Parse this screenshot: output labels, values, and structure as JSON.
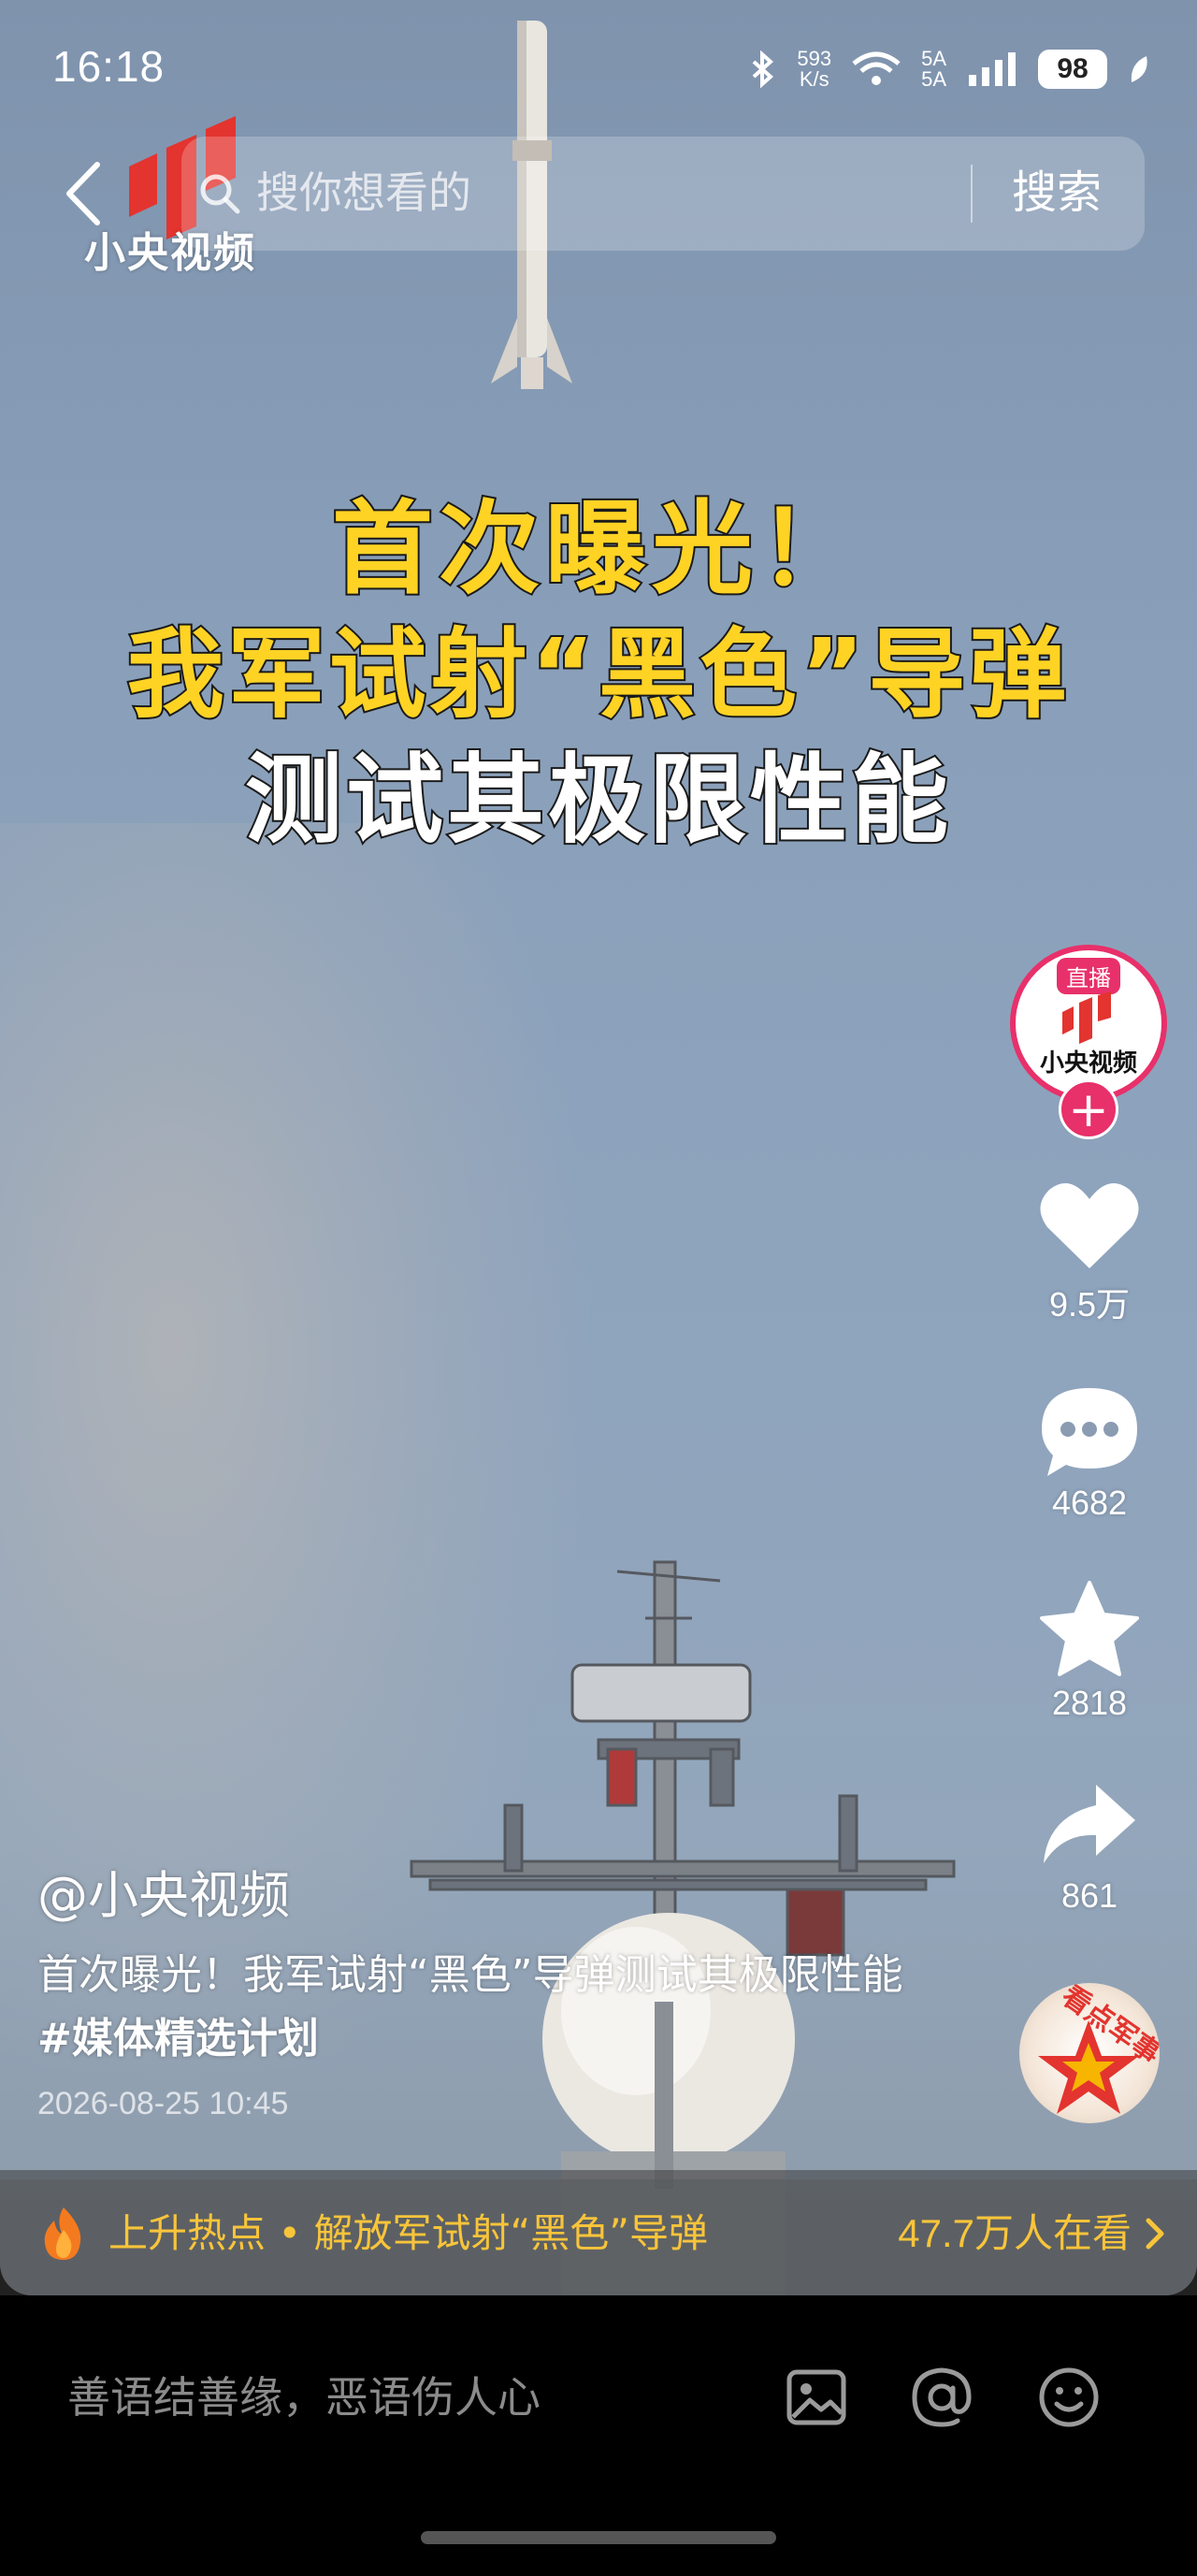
{
  "status_bar": {
    "time": "16:18",
    "net_speed_value": "593",
    "net_speed_unit": "K/s",
    "signal_1": "5A",
    "signal_2": "5A",
    "battery": "98",
    "icons": [
      "bluetooth-icon",
      "wifi-icon",
      "signal-icon",
      "battery-icon",
      "leaf-icon"
    ]
  },
  "header": {
    "logo_text": "小央视频",
    "search_placeholder": "搜你想看的",
    "search_button": "搜索"
  },
  "video": {
    "headline_line1": "首次曝光！",
    "headline_line2": "我军试射“黑色”导弹",
    "headline_line3": "测试其极限性能"
  },
  "rail": {
    "live_badge": "直播",
    "avatar_text": "小央视频",
    "follow": "+",
    "likes": "9.5万",
    "comments": "4682",
    "favorites": "2818",
    "shares": "861",
    "music_disc_text": "看点军事"
  },
  "post": {
    "author": "@小央视频",
    "caption": "首次曝光！我军试射“黑色”导弹测试其极限性能",
    "hashtag": "#媒体精选计划",
    "date": "2026-08-25 10:45"
  },
  "trending": {
    "text": "上升热点 • 解放军试射“黑色”导弹",
    "viewers": "47.7万人在看"
  },
  "comment_bar": {
    "placeholder": "善语结善缘，恶语伤人心"
  },
  "colors": {
    "accent_pink": "#e8306a",
    "headline_yellow": "#ffd324",
    "trend_yellow": "#f8c43a",
    "logo_red": "#e3342f"
  }
}
